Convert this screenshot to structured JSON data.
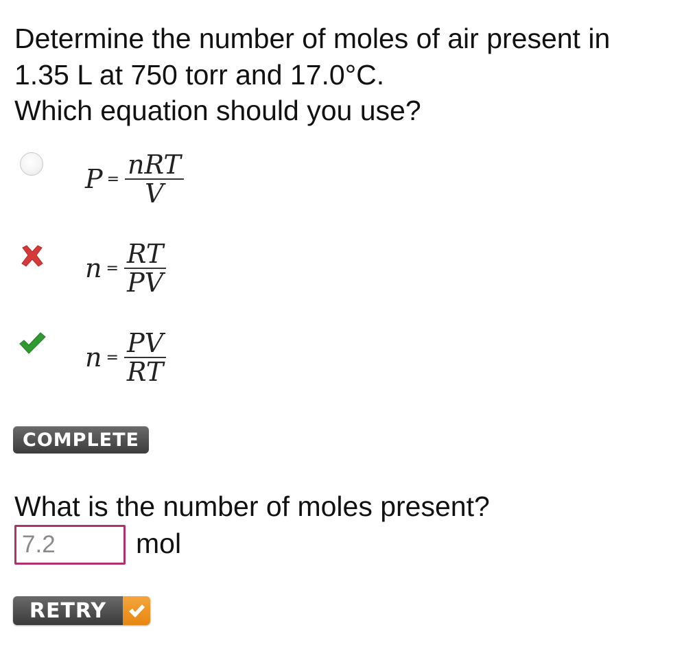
{
  "question": {
    "line1": "Determine the number of moles of air present in",
    "line2": "1.35 L at 750 torr and 17.0°C.",
    "line3": "Which equation should you use?"
  },
  "options": [
    {
      "lhs": "P",
      "equals": "=",
      "numerator": "nRT",
      "denominator": "V",
      "status": "unselected",
      "icon": "radio-icon"
    },
    {
      "lhs": "n",
      "equals": "=",
      "numerator": "RT",
      "denominator": "PV",
      "status": "incorrect",
      "icon": "x-mark-icon"
    },
    {
      "lhs": "n",
      "equals": "=",
      "numerator": "PV",
      "denominator": "RT",
      "status": "correct",
      "icon": "checkmark-icon"
    }
  ],
  "status_badge": "COMPLETE",
  "question2": {
    "text": "What is the number of moles present?",
    "input_value": "7.2",
    "unit": "mol"
  },
  "retry_button": {
    "label": "RETRY",
    "icon": "checkmark-icon"
  },
  "colors": {
    "incorrect": "#d53a3a",
    "correct": "#2f9a2f",
    "input_border": "#b0306a",
    "retry_accent": "#f0972a",
    "badge_bg": "#4a4a4a"
  }
}
